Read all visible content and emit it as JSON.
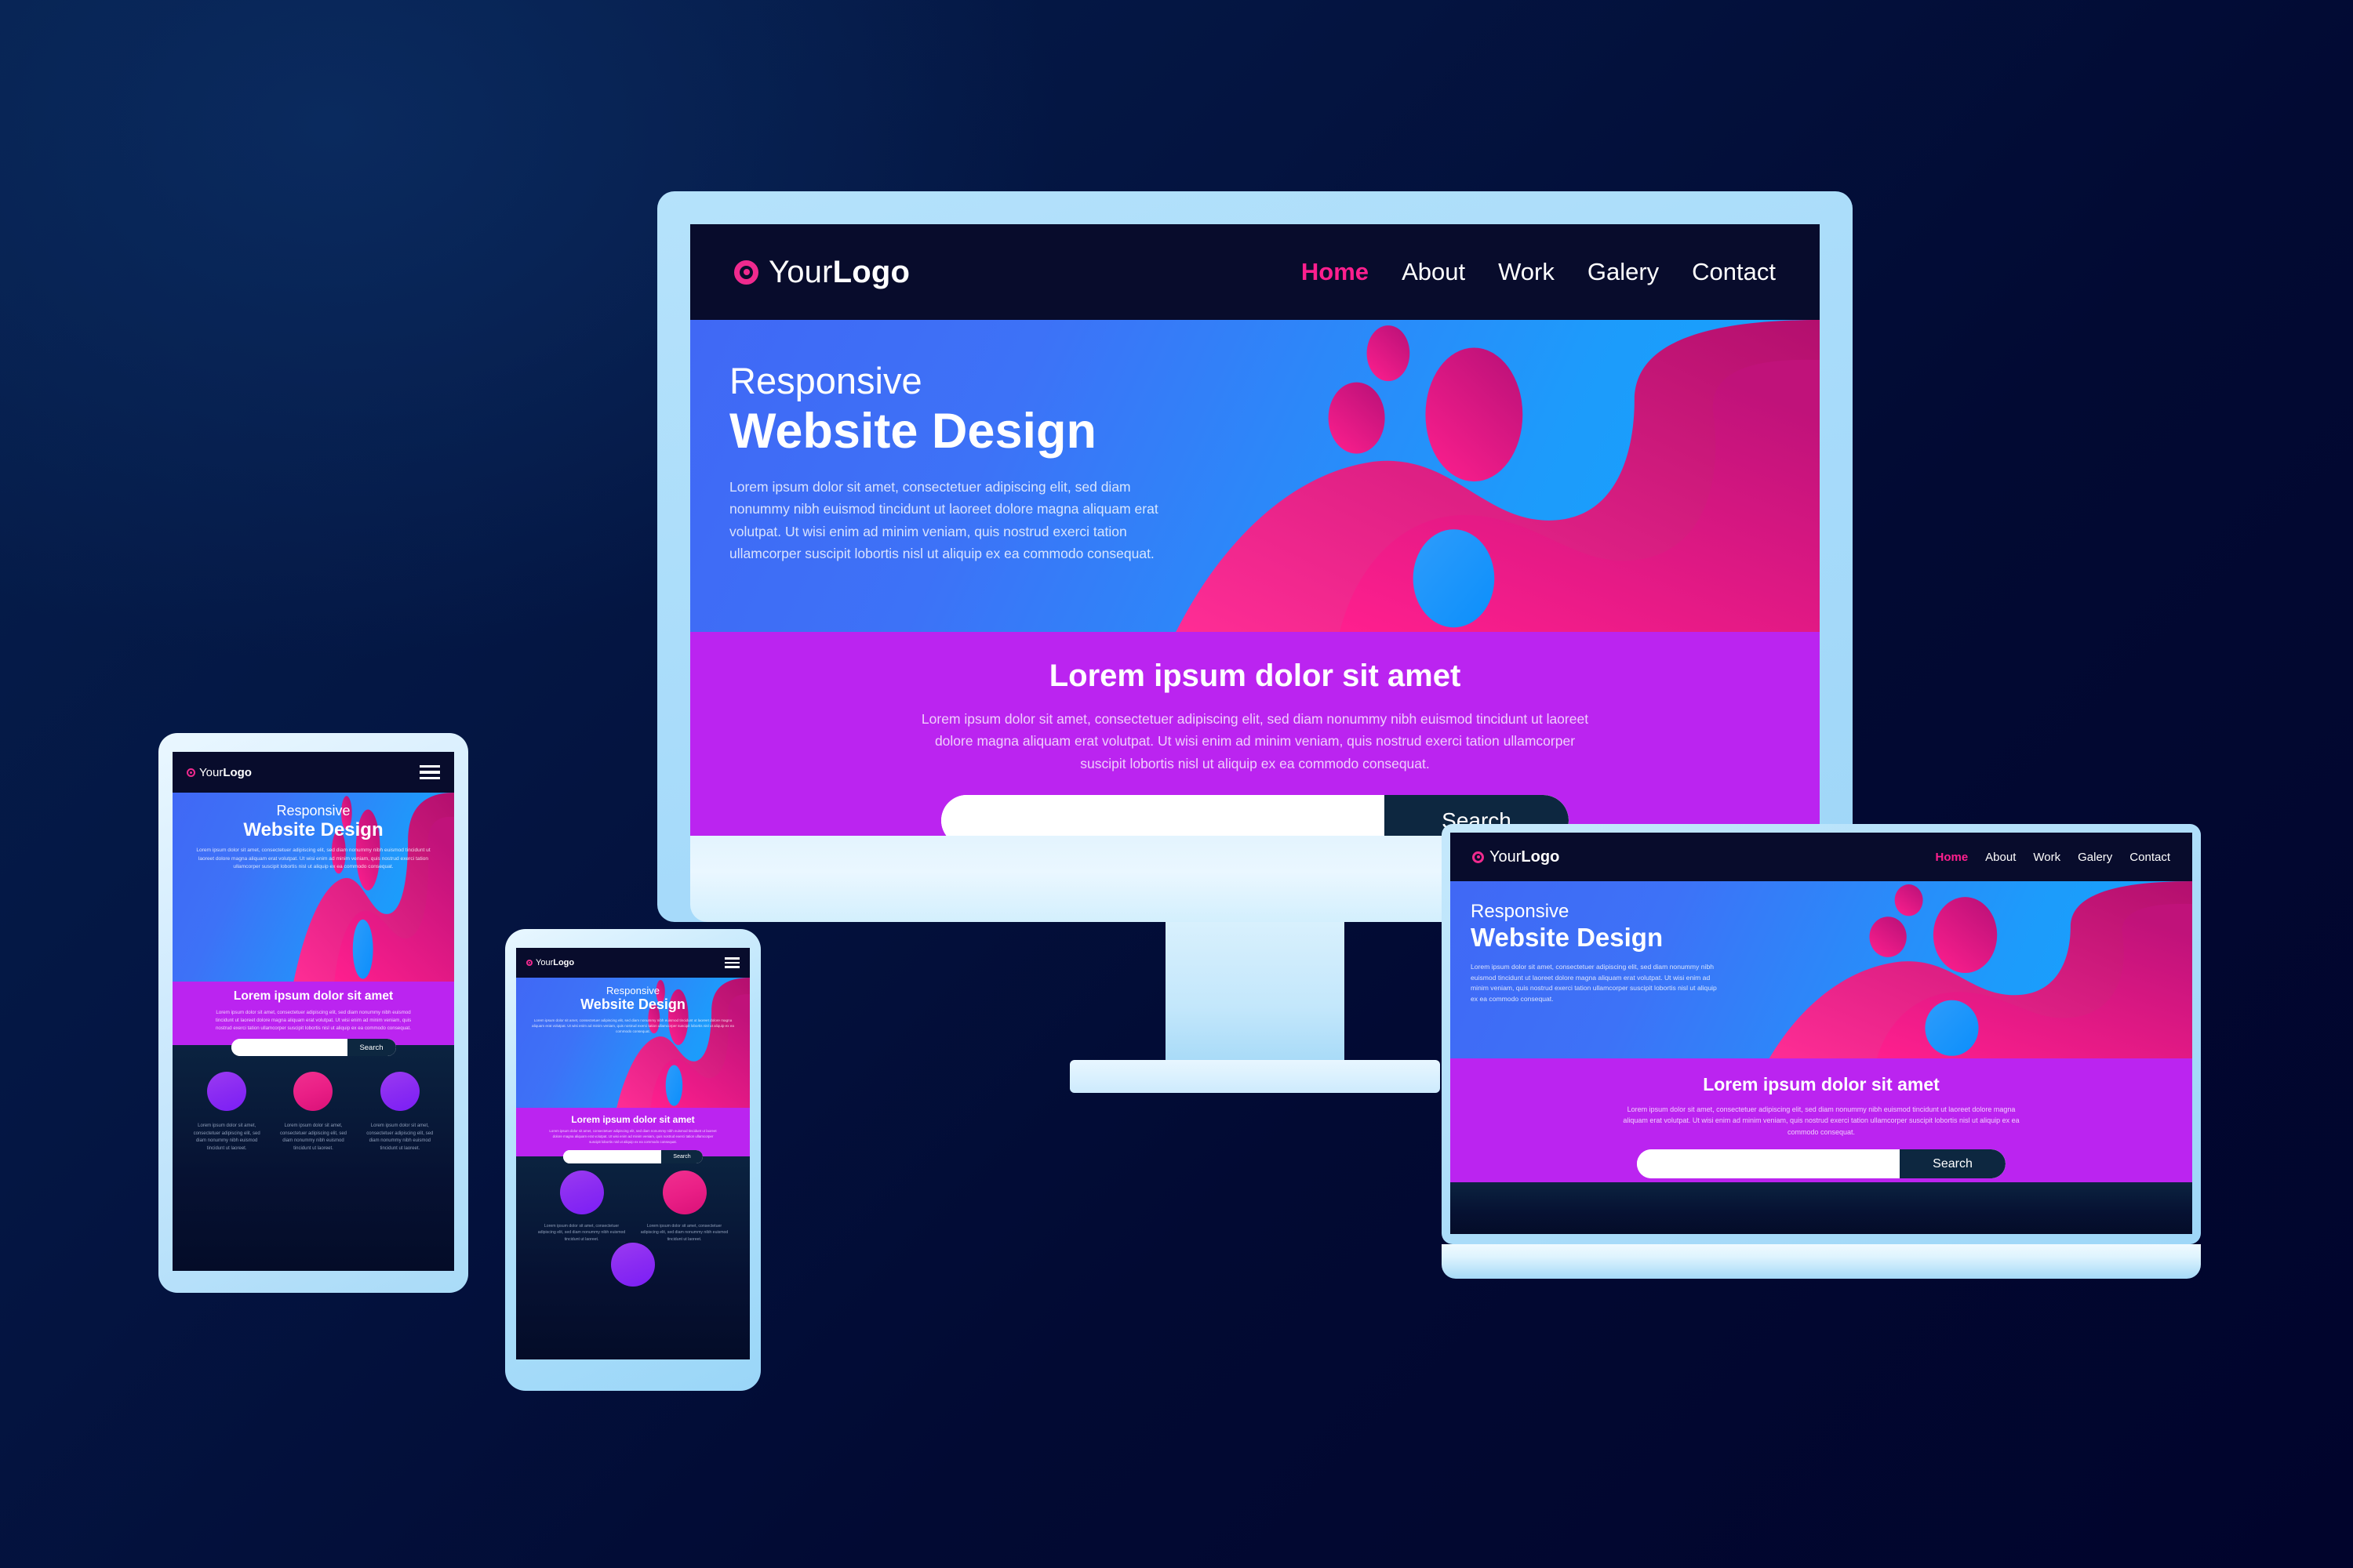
{
  "brand": {
    "logo_icon": "target-ring-icon",
    "logo_text_light": "Your",
    "logo_text_bold": "Logo",
    "accent_pink": "#ff1f8e",
    "accent_purple": "#bb24f0",
    "hero_blue": "#1d9bfb",
    "dark_navy": "#080c2c"
  },
  "nav": {
    "items": [
      {
        "label": "Home",
        "active": true
      },
      {
        "label": "About",
        "active": false
      },
      {
        "label": "Work",
        "active": false
      },
      {
        "label": "Galery",
        "active": false
      },
      {
        "label": "Contact",
        "active": false
      }
    ],
    "menu_icon": "hamburger-icon"
  },
  "hero": {
    "subtitle": "Responsive",
    "title": "Website Design",
    "paragraph": "Lorem ipsum dolor sit amet, consectetuer adipiscing elit, sed diam nonummy nibh euismod tincidunt ut laoreet dolore magna aliquam erat volutpat. Ut wisi enim ad minim veniam, quis nostrud exerci tation ullamcorper suscipit lobortis nisl ut aliquip ex ea commodo consequat."
  },
  "promo": {
    "heading": "Lorem ipsum dolor sit amet",
    "paragraph": "Lorem ipsum dolor sit amet, consectetuer adipiscing elit, sed diam nonummy nibh euismod tincidunt ut laoreet dolore magna aliquam erat volutpat. Ut wisi enim ad minim veniam, quis nostrud exerci tation ullamcorper suscipit lobortis nisl ut aliquip ex ea commodo consequat.",
    "search_value": "",
    "search_placeholder": "",
    "search_button": "Search"
  },
  "features": {
    "text": "Lorem ipsum dolor sit amet, consectetuer adipiscing elit, sed diam nonummy nibh euismod tincidunt ut laoreet.",
    "items": [
      {
        "color": "purple"
      },
      {
        "color": "pink"
      },
      {
        "color": "purple"
      }
    ]
  },
  "devices": {
    "monitor": "desktop-monitor",
    "tablet": "tablet",
    "phone": "smartphone",
    "laptop": "laptop"
  }
}
